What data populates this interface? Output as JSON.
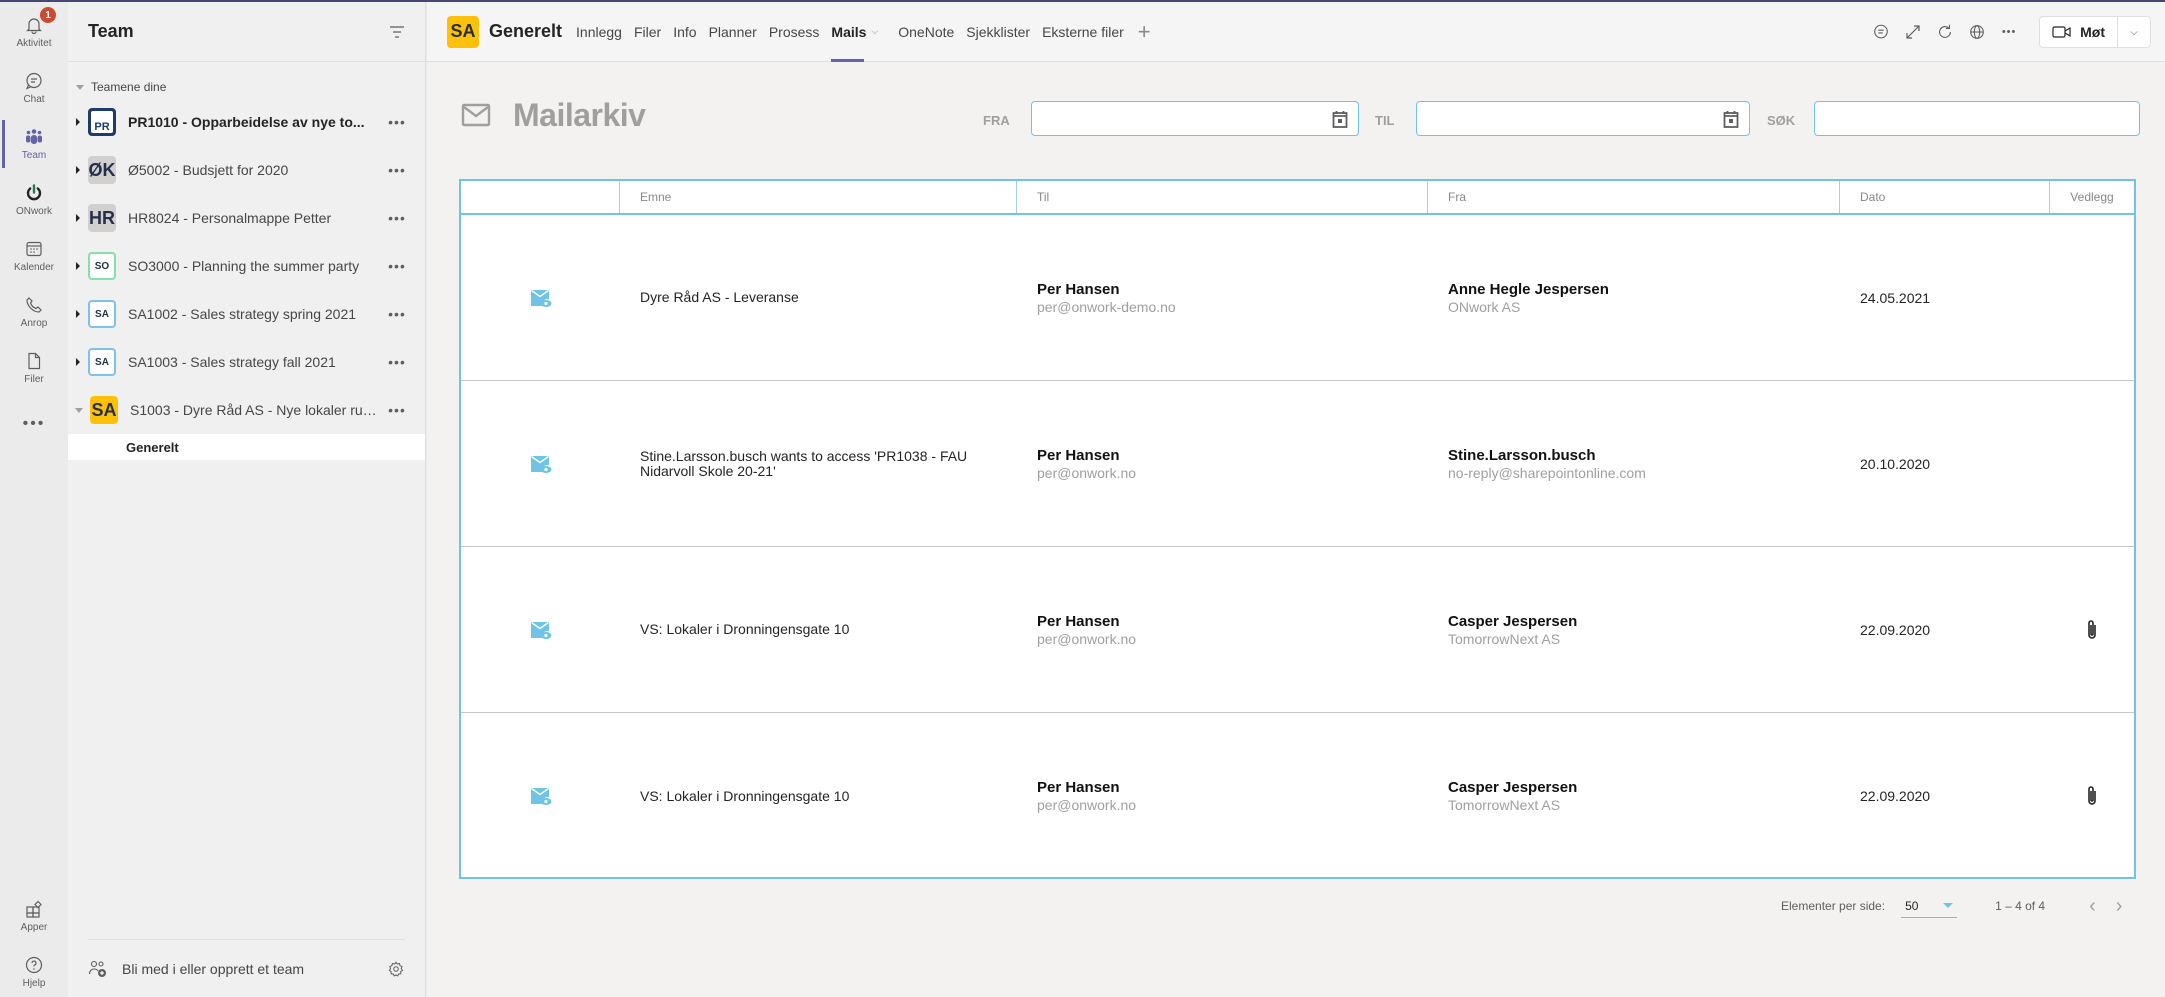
{
  "rail": {
    "items": [
      {
        "label": "Aktivitet",
        "icon": "bell-icon",
        "badge": "1"
      },
      {
        "label": "Chat",
        "icon": "chat-icon"
      },
      {
        "label": "Team",
        "icon": "teams-icon",
        "active": true
      },
      {
        "label": "ONwork",
        "icon": "power-icon"
      },
      {
        "label": "Kalender",
        "icon": "calendar-icon"
      },
      {
        "label": "Anrop",
        "icon": "phone-icon"
      },
      {
        "label": "Filer",
        "icon": "file-icon"
      },
      {
        "label": "...",
        "icon": "more-icon"
      }
    ],
    "bottom": [
      {
        "label": "Apper",
        "icon": "apps-icon"
      },
      {
        "label": "Hjelp",
        "icon": "help-icon"
      }
    ]
  },
  "team_panel": {
    "title": "Team",
    "section_label": "Teamene dine",
    "teams": [
      {
        "avatar": "PR",
        "name": "PR1010 - Opparbeidelse av nye to...",
        "bold": true
      },
      {
        "avatar": "ØK",
        "name": "Ø5002 - Budsjett for 2020"
      },
      {
        "avatar": "HR",
        "name": "HR8024 - Personalmappe Petter"
      },
      {
        "avatar": "SO",
        "name": "SO3000 - Planning the summer party"
      },
      {
        "avatar": "SA",
        "name": "SA1002 - Sales strategy spring 2021"
      },
      {
        "avatar": "SA",
        "name": "SA1003 - Sales strategy fall 2021"
      },
      {
        "avatar": "SA",
        "name": "S1003 - Dyre Råd AS - Nye lokaler run...",
        "expanded": true
      }
    ],
    "channel": "Generelt",
    "footer_label": "Bli med i eller opprett et team"
  },
  "channel_bar": {
    "avatar": "SA",
    "name": "Generelt",
    "tabs": [
      "Innlegg",
      "Filer",
      "Info",
      "Planner",
      "Prosess",
      "Mails",
      "OneNote",
      "Sjekklister",
      "Eksterne filer"
    ],
    "active_tab": "Mails",
    "meet_label": "Møt"
  },
  "mailarchive": {
    "title": "Mailarkiv",
    "filters": {
      "from_label": "FRA",
      "from_value": "",
      "to_label": "TIL",
      "to_value": "",
      "search_label": "SØK",
      "search_value": ""
    },
    "columns": [
      "",
      "Emne",
      "Til",
      "Fra",
      "Dato",
      "Vedlegg"
    ],
    "rows": [
      {
        "subject": "Dyre Råd AS - Leveranse",
        "to_name": "Per Hansen",
        "to_email": "per@onwork-demo.no",
        "from_name": "Anne Hegle Jespersen",
        "from_org": "ONwork AS",
        "date": "24.05.2021",
        "attachment": false
      },
      {
        "subject": "Stine.Larsson.busch wants to access 'PR1038 - FAU Nidarvoll Skole 20-21'",
        "to_name": "Per Hansen",
        "to_email": "per@onwork.no",
        "from_name": "Stine.Larsson.busch",
        "from_org": "no-reply@sharepointonline.com",
        "date": "20.10.2020",
        "attachment": false
      },
      {
        "subject": "VS: Lokaler i Dronningensgate 10",
        "to_name": "Per Hansen",
        "to_email": "per@onwork.no",
        "from_name": "Casper Jespersen",
        "from_org": "TomorrowNext AS",
        "date": "22.09.2020",
        "attachment": true
      },
      {
        "subject": "VS: Lokaler i Dronningensgate 10",
        "to_name": "Per Hansen",
        "to_email": "per@onwork.no",
        "from_name": "Casper Jespersen",
        "from_org": "TomorrowNext AS",
        "date": "22.09.2020",
        "attachment": true
      }
    ],
    "pager": {
      "per_page_label": "Elementer per side:",
      "per_page_value": "50",
      "range": "1 – 4 of 4"
    }
  },
  "colors": {
    "accent": "#6264a7",
    "grid_border": "#6ec3e6",
    "mail_icon": "#6ec3e6",
    "team_yellow": "#ffc107",
    "badge": "#cc4a31"
  }
}
